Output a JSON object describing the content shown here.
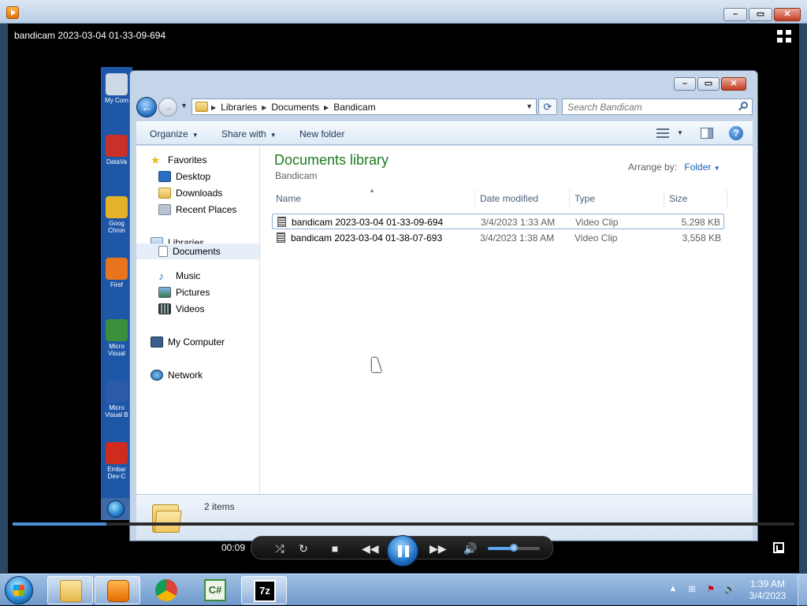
{
  "player": {
    "video_title": "bandicam 2023-03-04 01-33-09-694",
    "current_time": "00:09",
    "seek_progress": 0.12,
    "volume_level": 0.5
  },
  "explorer": {
    "address_crumbs": [
      "Libraries",
      "Documents",
      "Bandicam"
    ],
    "search_placeholder": "Search Bandicam",
    "toolbar": {
      "organize": "Organize",
      "share_with": "Share with",
      "new_folder": "New folder"
    },
    "nav": {
      "favorites": "Favorites",
      "desktop": "Desktop",
      "downloads": "Downloads",
      "recent_places": "Recent Places",
      "libraries": "Libraries",
      "documents": "Documents",
      "music": "Music",
      "pictures": "Pictures",
      "videos": "Videos",
      "my_computer": "My Computer",
      "network": "Network"
    },
    "library_title": "Documents library",
    "library_subtitle": "Bandicam",
    "arrange_label": "Arrange by:",
    "arrange_value": "Folder",
    "columns": [
      "Name",
      "Date modified",
      "Type",
      "Size"
    ],
    "files": [
      {
        "name": "bandicam 2023-03-04 01-33-09-694",
        "date": "3/4/2023 1:33 AM",
        "type": "Video Clip",
        "size": "5,298 KB"
      },
      {
        "name": "bandicam 2023-03-04 01-38-07-693",
        "date": "3/4/2023 1:38 AM",
        "type": "Video Clip",
        "size": "3,558 KB"
      }
    ],
    "items_count": "2 items"
  },
  "inner_desktop_icons": [
    {
      "label": "My Com",
      "icon": "computer-icon",
      "color": "#cfd9e6"
    },
    {
      "label": "DataVa",
      "icon": "dataval-icon",
      "color": "#c8302a"
    },
    {
      "label": "Goog Chron",
      "icon": "chrome-icon",
      "color": "#e4b32a"
    },
    {
      "label": "Firef",
      "icon": "firefox-icon",
      "color": "#e8741d"
    },
    {
      "label": "Micro Visual",
      "icon": "visual-csharp-icon",
      "color": "#3a8f3a"
    },
    {
      "label": "Micro Visual B",
      "icon": "visual-basic-icon",
      "color": "#2a5aa8"
    },
    {
      "label": "Embar Dev-C",
      "icon": "devcpp-icon",
      "color": "#d02b1f"
    }
  ],
  "taskbar": {
    "time": "1:39 AM",
    "date": "3/4/2023",
    "apps": [
      "explorer-icon",
      "media-player-icon",
      "chrome-icon",
      "visual-csharp-icon",
      "7zip-icon"
    ],
    "tray_icons": [
      "show-hidden-icon",
      "network-icon",
      "action-center-icon",
      "volume-icon"
    ]
  }
}
